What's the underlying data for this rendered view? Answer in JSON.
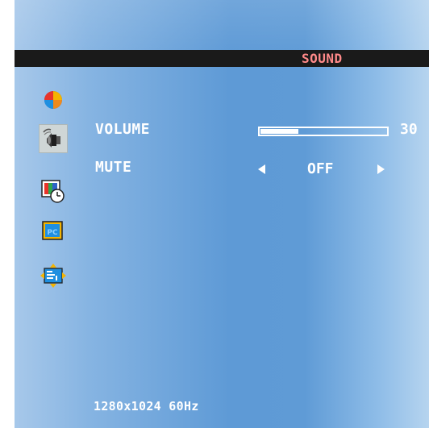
{
  "osd": {
    "menu_title": "SOUND",
    "title_color": "#ff8a8a",
    "icons": [
      {
        "name": "color-icon",
        "selected": false
      },
      {
        "name": "sound-icon",
        "selected": true
      },
      {
        "name": "osd-timer-icon",
        "selected": false
      },
      {
        "name": "pc-icon",
        "selected": false
      },
      {
        "name": "position-icon",
        "selected": false
      }
    ],
    "volume": {
      "label": "VOLUME",
      "value": "30",
      "level_fraction": 0.3
    },
    "mute": {
      "label": "MUTE",
      "value": "OFF"
    },
    "resolution": "1280x1024 60Hz"
  }
}
